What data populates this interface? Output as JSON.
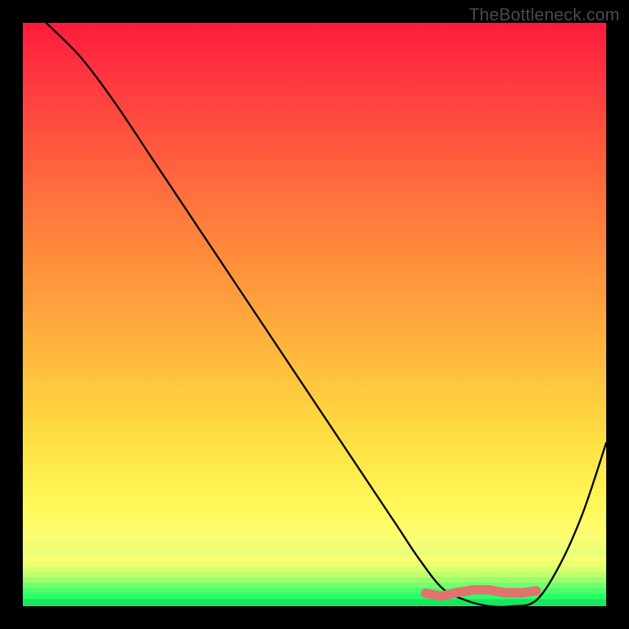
{
  "watermark": "TheBottleneck.com",
  "chart_data": {
    "type": "line",
    "title": "",
    "xlabel": "",
    "ylabel": "",
    "xlim": [
      0,
      100
    ],
    "ylim": [
      0,
      100
    ],
    "x": [
      4,
      10,
      16,
      22,
      28,
      34,
      40,
      46,
      52,
      58,
      64,
      68,
      72,
      76,
      80,
      84,
      88,
      92,
      96,
      100
    ],
    "y": [
      100,
      94,
      86,
      77,
      68,
      59,
      50,
      41,
      32,
      23,
      14,
      8,
      3,
      1,
      0,
      0,
      1,
      7,
      16,
      28
    ],
    "optimal_band": {
      "x_start": 69,
      "x_end": 88,
      "y": 2.5
    },
    "annotations": []
  },
  "colors": {
    "curve": "#000000",
    "band": "#e0736f"
  }
}
